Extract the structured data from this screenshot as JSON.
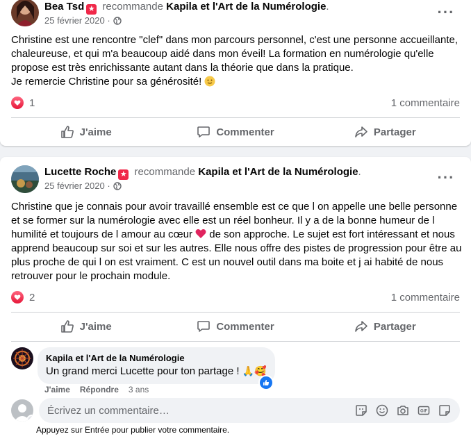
{
  "post1": {
    "author": "Bea Tsd",
    "recommends": "recommande",
    "page": "Kapila et l'Art de la Numérologie",
    "page_suffix": ".",
    "date": "25 février 2020 ·",
    "text": "Christine est une rencontre \"clef\" dans mon parcours personnel, c'est une personne accueillante, chaleureuse, et qui m'a beaucoup aidé dans mon éveil! La formation en numérologie qu'elle propose est très enrichissante autant dans la théorie que dans la pratique.",
    "text2": "Je remercie Christine pour sa générosité!",
    "reactions": "1",
    "comments": "1 commentaire"
  },
  "post2": {
    "author": "Lucette Roche",
    "recommends": "recommande",
    "page": "Kapila et l'Art de la Numérologie",
    "page_suffix": ".",
    "date": "25 février 2020 ·",
    "text_a": "Christine que je connais pour avoir travaillé ensemble est ce que l on appelle une belle personne et se former sur la numérologie avec elle est un réel bonheur. Il y a de la bonne humeur de l humilité et toujours de l amour au cœur",
    "text_b": "de son approche. Le sujet est fort intéressant et nous apprend beaucoup sur soi et sur les autres. Elle nous offre des pistes de progression pour être au plus proche de qui l on est vraiment. C est un nouvel outil dans ma boite et j ai habité de nous retrouver pour le prochain module.",
    "reactions": "2",
    "comments": "1 commentaire"
  },
  "actions": {
    "like": "J'aime",
    "comment": "Commenter",
    "share": "Partager"
  },
  "comment": {
    "author": "Kapila et l'Art de la Numérologie",
    "text": "Un grand merci Lucette pour ton partage !",
    "emojis": "🙏🥰",
    "like": "J'aime",
    "reply": "Répondre",
    "age": "3 ans"
  },
  "composer": {
    "placeholder": "Écrivez un commentaire…",
    "hint": "Appuyez sur Entrée pour publier votre commentaire."
  },
  "colors": {
    "reaction_red": "#f02849",
    "like_blue": "#1877f2",
    "meta_gray": "#65676b"
  }
}
